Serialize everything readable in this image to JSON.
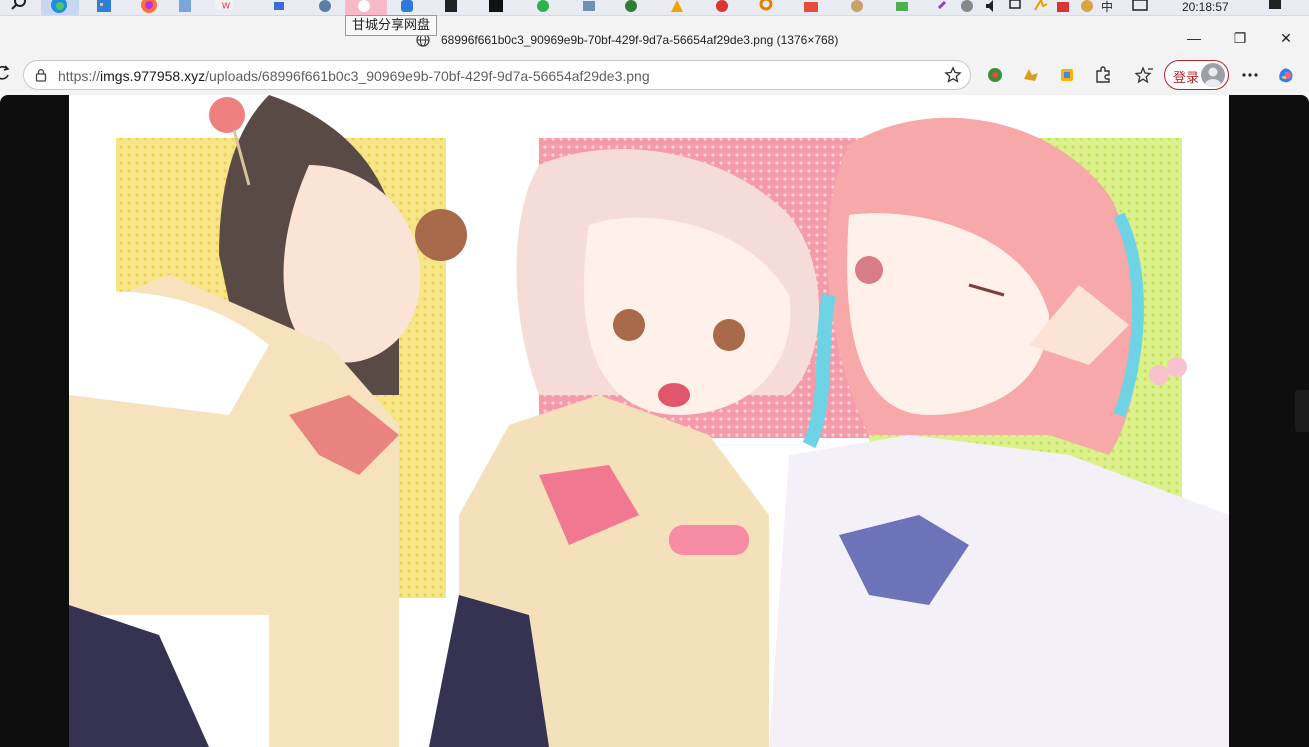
{
  "taskbar": {
    "tooltip": "甘城分享网盘",
    "tray_lang": "中",
    "clock": "20:18:57"
  },
  "window": {
    "title": "68996f661b0c3_90969e9b-70bf-429f-9d7a-56654af29de3.png (1376×768)",
    "minimize_glyph": "—",
    "maximize_glyph": "❐",
    "close_glyph": "✕"
  },
  "toolbar": {
    "url_scheme": "https://",
    "url_host": "imgs.977958.xyz",
    "url_path": "/uploads/68996f661b0c3_90969e9b-70bf-429f-9d7a-56654af29de3.png",
    "login_label": "登录",
    "more_glyph": "···"
  },
  "colors": {
    "accent_login": "#b3262b",
    "page_background": "#0e0e0e",
    "image_background": "#ffffff"
  },
  "content": {
    "image_description_icon": "anime-illustration-image"
  }
}
